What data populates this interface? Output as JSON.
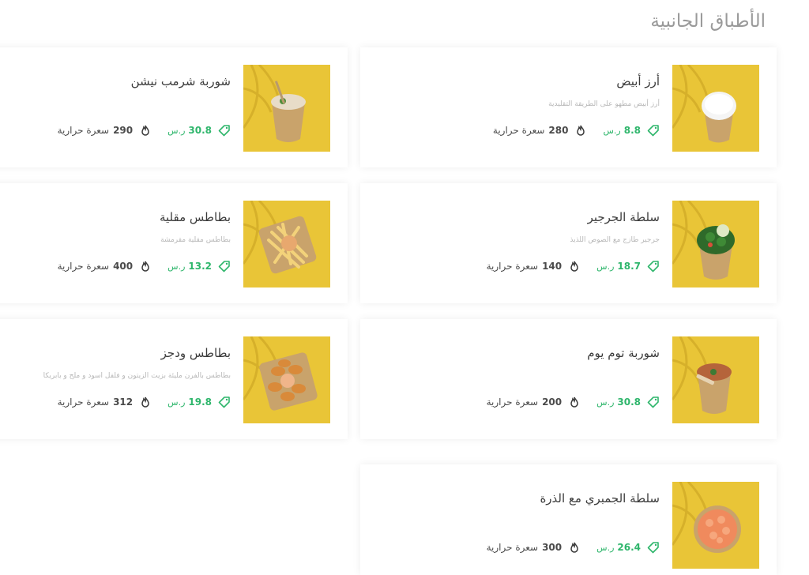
{
  "section": {
    "title": "الأطباق الجانبية"
  },
  "units": {
    "currency": "ر.س",
    "calories_label": "سعرة حرارية"
  },
  "colors": {
    "accent": "#2fb66c",
    "image_bg": "#e9c537",
    "title": "#9a9a9a"
  },
  "items": [
    {
      "name": "أرز أبيض",
      "description": "أرز أبيض مطهو على الطريقة التقليدية",
      "price": "8.8",
      "calories": "280",
      "image": "white-rice"
    },
    {
      "name": "شوربة شرمب نيشن",
      "description": "",
      "price": "30.8",
      "calories": "290",
      "image": "shrimp-soup"
    },
    {
      "name": "سلطة الجرجير",
      "description": "جرجير طازج مع الصوص اللذيذ",
      "price": "18.7",
      "calories": "140",
      "image": "arugula-salad"
    },
    {
      "name": "بطاطس مقلية",
      "description": "بطاطس مقلية مقرمشة",
      "price": "13.2",
      "calories": "400",
      "image": "french-fries"
    },
    {
      "name": "شوربة توم يوم",
      "description": "",
      "price": "30.8",
      "calories": "200",
      "image": "tom-yum-soup"
    },
    {
      "name": "بطاطس ودجز",
      "description": "بطاطس بالفرن مليئة بزيت الزيتون و فلفل اسود و ملح و بابريكا",
      "price": "19.8",
      "calories": "312",
      "image": "potato-wedges"
    },
    {
      "name": "سلطة الجمبري مع الذرة",
      "description": "",
      "price": "26.4",
      "calories": "300",
      "image": "shrimp-corn-salad"
    }
  ]
}
